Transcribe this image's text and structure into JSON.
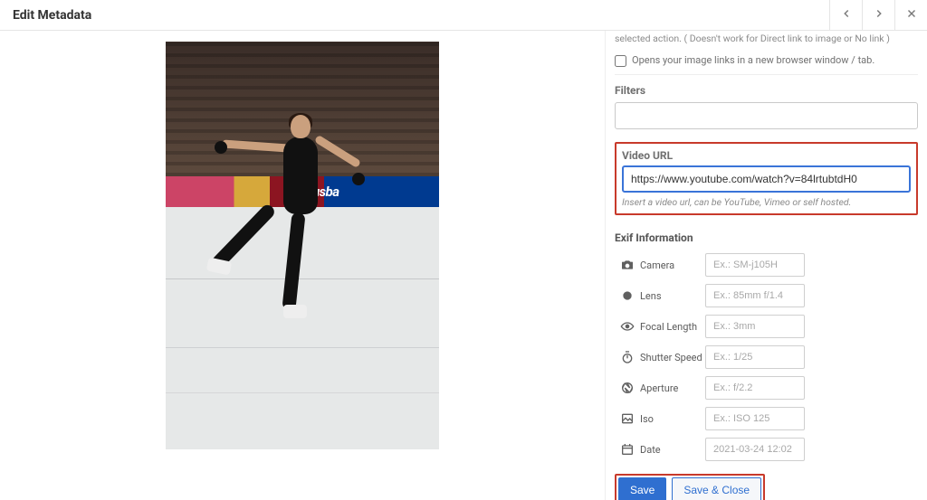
{
  "header": {
    "title": "Edit Metadata"
  },
  "link_help": "selected action. ( Doesn't work for Direct link to image or No link )",
  "checkbox_label": "Opens your image links in a new browser window / tab.",
  "checkbox_checked": false,
  "filters": {
    "title": "Filters",
    "value": ""
  },
  "video": {
    "title": "Video URL",
    "value": "https://www.youtube.com/watch?v=84lrtubtdH0",
    "help": "Insert a video url, can be YouTube, Vimeo or self hosted."
  },
  "exif": {
    "title": "Exif Information",
    "rows": [
      {
        "label": "Camera",
        "placeholder": "Ex.: SM-j105H",
        "value": ""
      },
      {
        "label": "Lens",
        "placeholder": "Ex.: 85mm f/1.4",
        "value": ""
      },
      {
        "label": "Focal Length",
        "placeholder": "Ex.: 3mm",
        "value": ""
      },
      {
        "label": "Shutter Speed",
        "placeholder": "Ex.: 1/25",
        "value": ""
      },
      {
        "label": "Aperture",
        "placeholder": "Ex.: f/2.2",
        "value": ""
      },
      {
        "label": "Iso",
        "placeholder": "Ex.: ISO 125",
        "value": ""
      },
      {
        "label": "Date",
        "placeholder": "2021-03-24 12:02",
        "value": ""
      }
    ]
  },
  "buttons": {
    "save": "Save",
    "save_close": "Save & Close"
  }
}
